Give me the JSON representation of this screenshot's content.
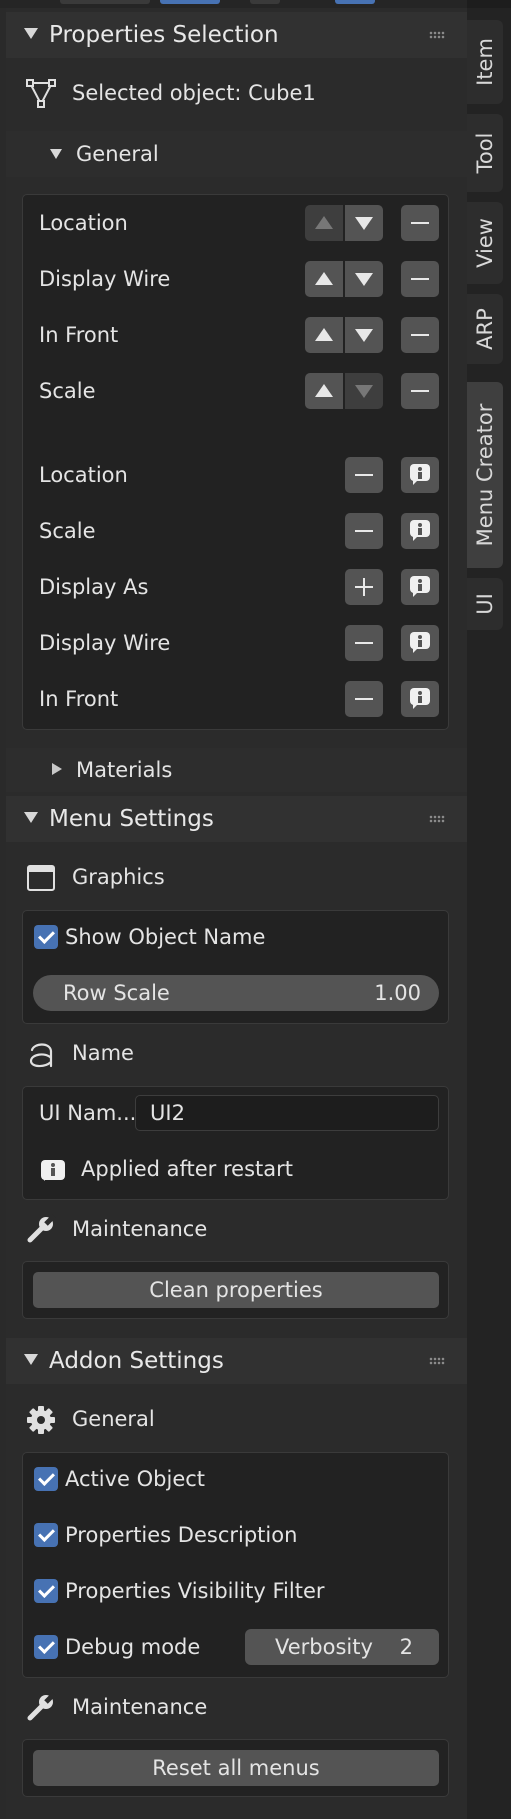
{
  "sidebar_tabs": [
    "Item",
    "Tool",
    "View",
    "ARP",
    "Menu Creator",
    "UI"
  ],
  "active_tab": "Menu Creator",
  "properties_panel": {
    "title": "Properties Selection",
    "selected_object": "Selected object: Cube1",
    "general_label": "General",
    "ordered_rows": [
      "Location",
      "Display Wire",
      "In Front",
      "Scale"
    ],
    "extra_rows": [
      "Location",
      "Scale",
      "Display As",
      "Display Wire",
      "In Front"
    ],
    "materials_label": "Materials"
  },
  "menu_settings": {
    "title": "Menu Settings",
    "graphics_label": "Graphics",
    "show_object_name": "Show Object Name",
    "row_scale_label": "Row Scale",
    "row_scale_value": "1.00",
    "name_label": "Name",
    "ui_name_label": "UI Nam...",
    "ui_name_value": "UI2",
    "applied_note": "Applied after restart",
    "maintenance_label": "Maintenance",
    "clean_button": "Clean properties"
  },
  "addon_settings": {
    "title": "Addon Settings",
    "general_label": "General",
    "active_object": "Active Object",
    "properties_description": "Properties Description",
    "visibility_filter": "Properties Visibility Filter",
    "debug_mode": "Debug mode",
    "verbosity_label": "Verbosity",
    "verbosity_value": "2",
    "maintenance_label": "Maintenance",
    "reset_button": "Reset all menus"
  },
  "colors": {
    "checkbox": "#4772b3",
    "panel": "#2b2b2b",
    "button": "#545454"
  }
}
